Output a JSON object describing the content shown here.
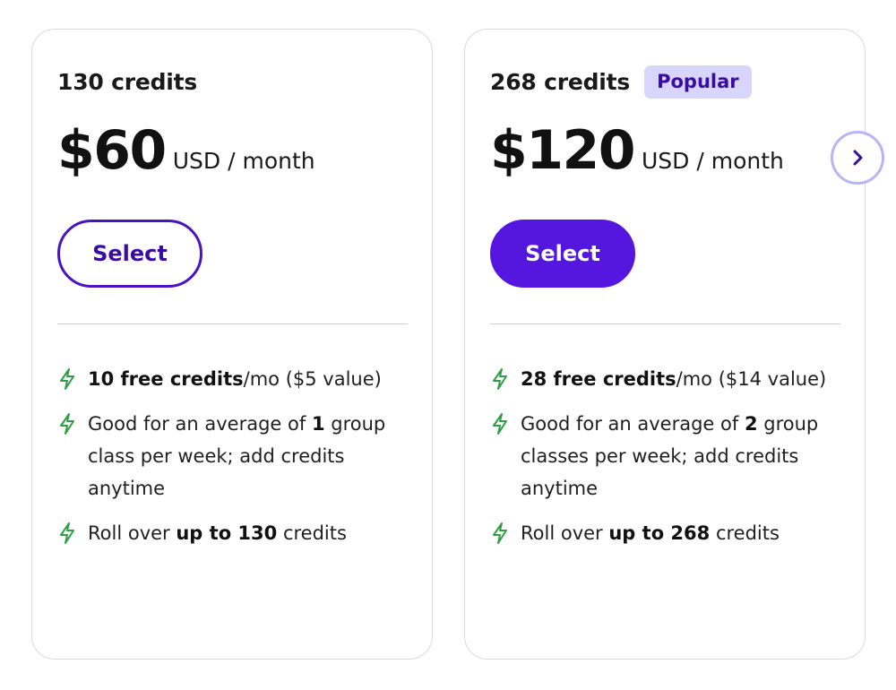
{
  "plans": [
    {
      "credits_title": "130 credits",
      "badge": "",
      "price": "$60",
      "price_unit": "USD / month",
      "button_label": "Select",
      "button_style": "outline",
      "features": [
        {
          "parts": [
            {
              "text": "10 free credits",
              "bold": true
            },
            {
              "text": "/mo ($5 value)",
              "bold": false
            }
          ]
        },
        {
          "parts": [
            {
              "text": "Good for an average of ",
              "bold": false
            },
            {
              "text": "1",
              "bold": true
            },
            {
              "text": " group class per week; add credits anytime",
              "bold": false
            }
          ]
        },
        {
          "parts": [
            {
              "text": "Roll over ",
              "bold": false
            },
            {
              "text": "up to 130",
              "bold": true
            },
            {
              "text": " credits",
              "bold": false
            }
          ]
        }
      ]
    },
    {
      "credits_title": "268 credits",
      "badge": "Popular",
      "price": "$120",
      "price_unit": "USD / month",
      "button_label": "Select",
      "button_style": "filled",
      "features": [
        {
          "parts": [
            {
              "text": "28 free credits",
              "bold": true
            },
            {
              "text": "/mo ($14 value)",
              "bold": false
            }
          ]
        },
        {
          "parts": [
            {
              "text": "Good for an average of ",
              "bold": false
            },
            {
              "text": "2",
              "bold": true
            },
            {
              "text": " group classes per week; add credits anytime",
              "bold": false
            }
          ]
        },
        {
          "parts": [
            {
              "text": "Roll over ",
              "bold": false
            },
            {
              "text": "up to 268",
              "bold": true
            },
            {
              "text": " credits",
              "bold": false
            }
          ]
        }
      ]
    }
  ],
  "icons": {
    "feature_icon": "lightning-bolt-icon",
    "next_icon": "chevron-right-icon"
  },
  "colors": {
    "brand_purple": "#5517e0",
    "outline_purple": "#4a13c2",
    "badge_bg": "#d8d6fd",
    "badge_text": "#3a0ca3",
    "bolt_green": "#2f9e44",
    "arrow_ring": "#b8b5f6"
  }
}
